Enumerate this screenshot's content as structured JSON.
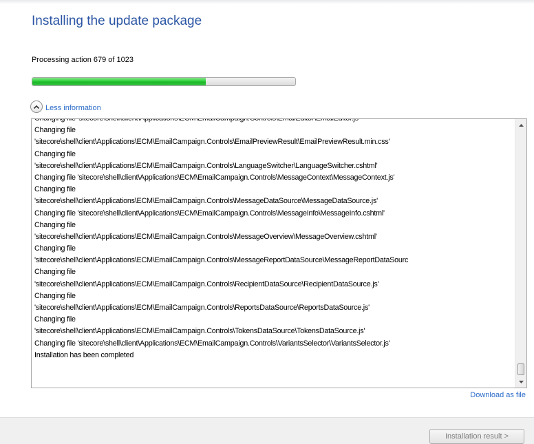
{
  "header": {
    "title": "Installing the update package"
  },
  "progress": {
    "status_text": "Processing action 679 of 1023",
    "current": 679,
    "total": 1023,
    "fraction": 0.66,
    "fill_color": "#2ed33b"
  },
  "details_toggle": {
    "label": "Less information",
    "icon": "chevron-up-circle-icon"
  },
  "log": {
    "lines": [
      "Changing file 'sitecore\\shell\\client\\Applications\\ECM\\EmailCampaign.Controls\\EmailEditor\\EmailEditor.js'",
      "Changing file",
      "'sitecore\\shell\\client\\Applications\\ECM\\EmailCampaign.Controls\\EmailPreviewResult\\EmailPreviewResult.min.css'",
      "Changing file",
      "'sitecore\\shell\\client\\Applications\\ECM\\EmailCampaign.Controls\\LanguageSwitcher\\LanguageSwitcher.cshtml'",
      "Changing file 'sitecore\\shell\\client\\Applications\\ECM\\EmailCampaign.Controls\\MessageContext\\MessageContext.js'",
      "Changing file",
      "'sitecore\\shell\\client\\Applications\\ECM\\EmailCampaign.Controls\\MessageDataSource\\MessageDataSource.js'",
      "Changing file 'sitecore\\shell\\client\\Applications\\ECM\\EmailCampaign.Controls\\MessageInfo\\MessageInfo.cshtml'",
      "Changing file",
      "'sitecore\\shell\\client\\Applications\\ECM\\EmailCampaign.Controls\\MessageOverview\\MessageOverview.cshtml'",
      "Changing file",
      "'sitecore\\shell\\client\\Applications\\ECM\\EmailCampaign.Controls\\MessageReportDataSource\\MessageReportDataSourc",
      "Changing file",
      "'sitecore\\shell\\client\\Applications\\ECM\\EmailCampaign.Controls\\RecipientDataSource\\RecipientDataSource.js'",
      "Changing file",
      "'sitecore\\shell\\client\\Applications\\ECM\\EmailCampaign.Controls\\ReportsDataSource\\ReportsDataSource.js'",
      "Changing file",
      "'sitecore\\shell\\client\\Applications\\ECM\\EmailCampaign.Controls\\TokensDataSource\\TokensDataSource.js'",
      "Changing file 'sitecore\\shell\\client\\Applications\\ECM\\EmailCampaign.Controls\\VariantsSelector\\VariantsSelector.js'",
      "Installation has been completed"
    ]
  },
  "download_link": {
    "label": "Download as file"
  },
  "footer": {
    "result_button_label": "Installation result >"
  }
}
